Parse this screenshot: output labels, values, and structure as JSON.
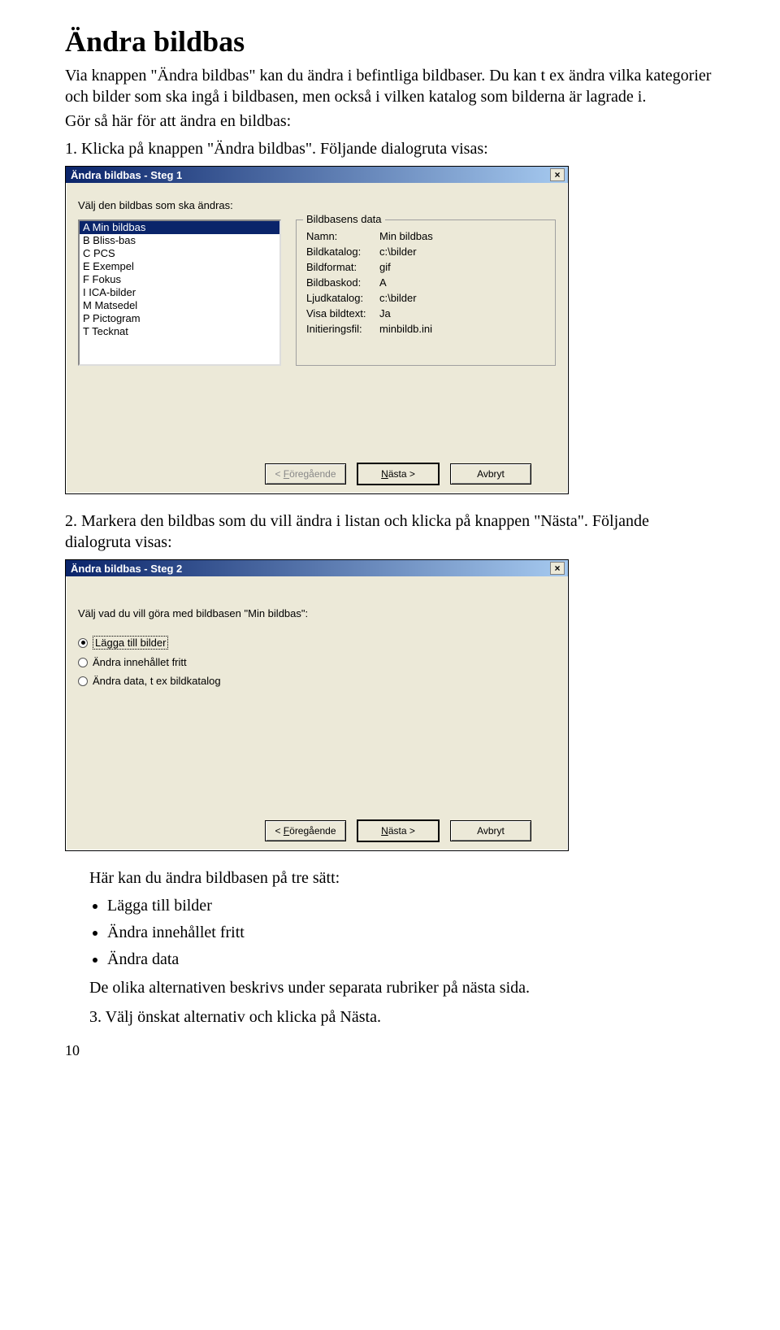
{
  "heading": "Ändra bildbas",
  "intro1": "Via knappen \"Ändra bildbas\" kan du ändra i befintliga bildbaser. Du kan t ex ändra vilka kategorier och bilder som ska ingå i bildbasen, men också i vilken katalog som bilderna är lagrade i.",
  "intro2": "Gör så här för att ändra en bildbas:",
  "step1": "1. Klicka på knappen \"Ändra bildbas\". Följande dialogruta visas:",
  "dialog1": {
    "title": "Ändra bildbas - Steg 1",
    "close": "×",
    "prompt": "Välj den bildbas som ska ändras:",
    "list": [
      "A  Min bildbas",
      "B  Bliss-bas",
      "C  PCS",
      "E  Exempel",
      "F  Fokus",
      "I  ICA-bilder",
      "M  Matsedel",
      "P  Pictogram",
      "T  Tecknat"
    ],
    "groupTitle": "Bildbasens data",
    "kv": [
      {
        "k": "Namn:",
        "v": "Min bildbas"
      },
      {
        "k": "Bildkatalog:",
        "v": "c:\\bilder"
      },
      {
        "k": "Bildformat:",
        "v": "gif"
      },
      {
        "k": "Bildbaskod:",
        "v": "A"
      },
      {
        "k": "Ljudkatalog:",
        "v": "c:\\bilder"
      },
      {
        "k": "Visa bildtext:",
        "v": "Ja"
      },
      {
        "k": "Initieringsfil:",
        "v": "minbildb.ini"
      }
    ],
    "prev": "< Föregående",
    "next": "Nästa >",
    "cancel": "Avbryt"
  },
  "step2": "2. Markera den bildbas som du vill ändra i listan och klicka på knappen \"Nästa\". Följande dialogruta visas:",
  "dialog2": {
    "title": "Ändra bildbas - Steg 2",
    "close": "×",
    "prompt": "Välj vad du vill göra med bildbasen \"Min bildbas\":",
    "options": [
      "Lägga till bilder",
      "Ändra innehållet fritt",
      "Ändra data, t ex bildkatalog"
    ],
    "prev": "< Föregående",
    "next": "Nästa >",
    "cancel": "Avbryt"
  },
  "after": {
    "line1": "Här kan du ändra bildbasen på tre sätt:",
    "bullets": [
      "Lägga till bilder",
      "Ändra innehållet fritt",
      "Ändra data"
    ],
    "line2": "De olika alternativen beskrivs under separata rubriker på nästa sida.",
    "line3": "3. Välj önskat alternativ och klicka på Nästa."
  },
  "pagenum": "10"
}
